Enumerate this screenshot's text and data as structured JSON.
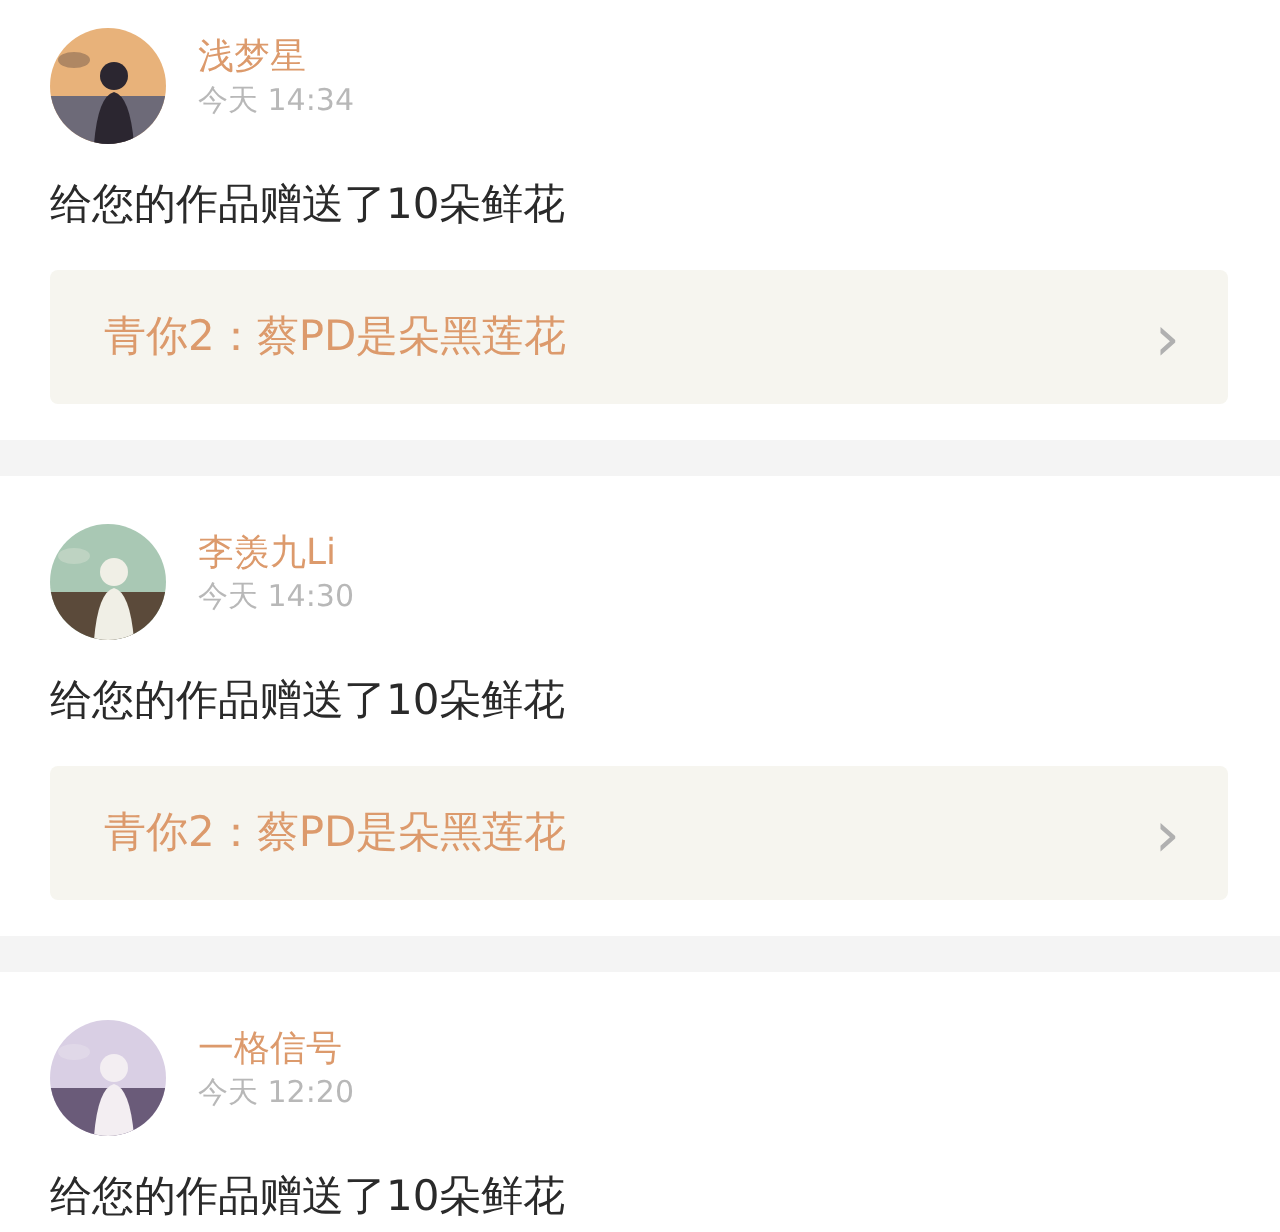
{
  "feed": [
    {
      "name": "浅梦星",
      "time": "今天 14:34",
      "message": "给您的作品赠送了10朵鲜花",
      "link": {
        "text": "青你2：蔡PD是朵黑莲花",
        "chevron": "›"
      }
    },
    {
      "name": "李羡九Li",
      "time": "今天 14:30",
      "message": "给您的作品赠送了10朵鲜花",
      "link": {
        "text": "青你2：蔡PD是朵黑莲花",
        "chevron": "›"
      }
    },
    {
      "name": "一格信号",
      "time": "今天 12:20",
      "message": "给您的作品赠送了10朵鲜花"
    }
  ]
}
